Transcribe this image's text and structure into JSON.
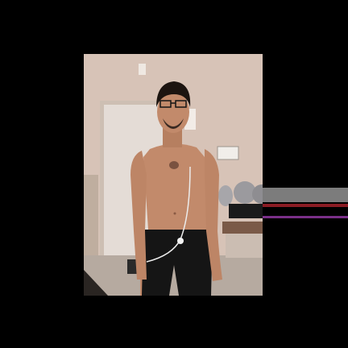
{
  "image": {
    "subject": "person-standing",
    "colors": {
      "background": "#000000",
      "wall": "#d7c3b7",
      "door": "#e4dcd6",
      "floor": "#b6aaa0",
      "skin": "#c28a6b",
      "hair": "#1c1410",
      "shorts": "#151515",
      "chair": "#9b9a9e",
      "artifact_purple": "#7a2f88",
      "artifact_red": "#8a1c24"
    }
  }
}
